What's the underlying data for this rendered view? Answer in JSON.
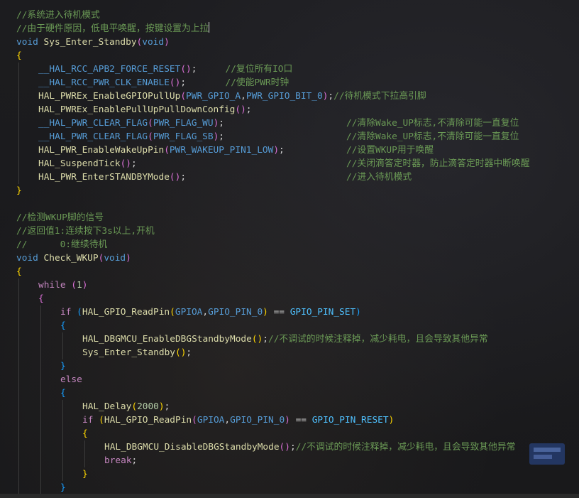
{
  "colors": {
    "comment": "#6a9955",
    "keyword": "#569cd6",
    "control": "#c586c0",
    "function": "#dcdcaa",
    "macro": "#569cd6",
    "constant": "#4fc1ff",
    "number": "#b5cea8",
    "punct": "#d4d4d4",
    "bracket1": "#ffd700",
    "bracket2": "#da70d6",
    "bracket3": "#179fff"
  },
  "editor": {
    "caret_line": 1,
    "lines": [
      {
        "indent": 0,
        "tokens": [
          {
            "t": "//系统进入待机模式",
            "c": "comment"
          }
        ]
      },
      {
        "indent": 0,
        "tokens": [
          {
            "t": "//由于硬件原因，低电平唤醒，按键设置为上拉",
            "c": "comment"
          }
        ]
      },
      {
        "indent": 0,
        "tokens": [
          {
            "t": "void",
            "c": "keyword"
          },
          {
            "t": " ",
            "c": "punct"
          },
          {
            "t": "Sys_Enter_Standby",
            "c": "function"
          },
          {
            "t": "(",
            "c": "bracket2"
          },
          {
            "t": "void",
            "c": "keyword"
          },
          {
            "t": ")",
            "c": "bracket2"
          }
        ]
      },
      {
        "indent": 0,
        "tokens": [
          {
            "t": "{",
            "c": "bracket1"
          }
        ]
      },
      {
        "indent": 1,
        "tokens": [
          {
            "t": "__HAL_RCC_APB2_FORCE_RESET",
            "c": "macro"
          },
          {
            "t": "()",
            "c": "bracket2"
          },
          {
            "t": ";",
            "c": "punct"
          }
        ],
        "comment_col": 38,
        "comment": "//复位所有IO口"
      },
      {
        "indent": 1,
        "tokens": [
          {
            "t": "__HAL_RCC_PWR_CLK_ENABLE",
            "c": "macro"
          },
          {
            "t": "()",
            "c": "bracket2"
          },
          {
            "t": ";",
            "c": "punct"
          }
        ],
        "comment_col": 38,
        "comment": "//使能PWR时钟"
      },
      {
        "indent": 1,
        "tokens": [
          {
            "t": "HAL_PWREx_EnableGPIOPullUp",
            "c": "function"
          },
          {
            "t": "(",
            "c": "bracket2"
          },
          {
            "t": "PWR_GPIO_A",
            "c": "macro"
          },
          {
            "t": ",",
            "c": "punct"
          },
          {
            "t": "PWR_GPIO_BIT_0",
            "c": "macro"
          },
          {
            "t": ")",
            "c": "bracket2"
          },
          {
            "t": ";",
            "c": "punct"
          },
          {
            "t": "//待机模式下拉高引脚",
            "c": "comment"
          }
        ]
      },
      {
        "indent": 1,
        "tokens": [
          {
            "t": "HAL_PWREx_EnablePullUpPullDownConfig",
            "c": "function"
          },
          {
            "t": "()",
            "c": "bracket2"
          },
          {
            "t": ";",
            "c": "punct"
          }
        ]
      },
      {
        "indent": 1,
        "tokens": [
          {
            "t": "__HAL_PWR_CLEAR_FLAG",
            "c": "macro"
          },
          {
            "t": "(",
            "c": "bracket2"
          },
          {
            "t": "PWR_FLAG_WU",
            "c": "macro"
          },
          {
            "t": ")",
            "c": "bracket2"
          },
          {
            "t": ";",
            "c": "punct"
          }
        ],
        "comment_col": 60,
        "comment": "//清除Wake_UP标志,不清除可能一直复位"
      },
      {
        "indent": 1,
        "tokens": [
          {
            "t": "__HAL_PWR_CLEAR_FLAG",
            "c": "macro"
          },
          {
            "t": "(",
            "c": "bracket2"
          },
          {
            "t": "PWR_FLAG_SB",
            "c": "macro"
          },
          {
            "t": ")",
            "c": "bracket2"
          },
          {
            "t": ";",
            "c": "punct"
          }
        ],
        "comment_col": 60,
        "comment": "//清除Wake_UP标志,不清除可能一直复位"
      },
      {
        "indent": 1,
        "tokens": [
          {
            "t": "HAL_PWR_EnableWakeUpPin",
            "c": "function"
          },
          {
            "t": "(",
            "c": "bracket2"
          },
          {
            "t": "PWR_WAKEUP_PIN1_LOW",
            "c": "macro"
          },
          {
            "t": ")",
            "c": "bracket2"
          },
          {
            "t": ";",
            "c": "punct"
          }
        ],
        "comment_col": 60,
        "comment": "//设置WKUP用于唤醒"
      },
      {
        "indent": 1,
        "tokens": [
          {
            "t": "HAL_SuspendTick",
            "c": "function"
          },
          {
            "t": "()",
            "c": "bracket2"
          },
          {
            "t": ";",
            "c": "punct"
          }
        ],
        "comment_col": 60,
        "comment": "//关闭滴答定时器，防止滴答定时器中断唤醒"
      },
      {
        "indent": 1,
        "tokens": [
          {
            "t": "HAL_PWR_EnterSTANDBYMode",
            "c": "function"
          },
          {
            "t": "()",
            "c": "bracket2"
          },
          {
            "t": ";",
            "c": "punct"
          }
        ],
        "comment_col": 60,
        "comment": "//进入待机模式"
      },
      {
        "indent": 0,
        "tokens": [
          {
            "t": "}",
            "c": "bracket1"
          }
        ]
      },
      {
        "indent": 0,
        "tokens": []
      },
      {
        "indent": 0,
        "tokens": [
          {
            "t": "//检测WKUP脚的信号",
            "c": "comment"
          }
        ]
      },
      {
        "indent": 0,
        "tokens": [
          {
            "t": "//返回值1:连续按下3s以上,开机",
            "c": "comment"
          }
        ]
      },
      {
        "indent": 0,
        "tokens": [
          {
            "t": "//      0:继续待机",
            "c": "comment"
          }
        ]
      },
      {
        "indent": 0,
        "tokens": [
          {
            "t": "void",
            "c": "keyword"
          },
          {
            "t": " ",
            "c": "punct"
          },
          {
            "t": "Check_WKUP",
            "c": "function"
          },
          {
            "t": "(",
            "c": "bracket2"
          },
          {
            "t": "void",
            "c": "keyword"
          },
          {
            "t": ")",
            "c": "bracket2"
          }
        ]
      },
      {
        "indent": 0,
        "tokens": [
          {
            "t": "{",
            "c": "bracket1"
          }
        ]
      },
      {
        "indent": 1,
        "tokens": [
          {
            "t": "while",
            "c": "control"
          },
          {
            "t": " ",
            "c": "punct"
          },
          {
            "t": "(",
            "c": "bracket2"
          },
          {
            "t": "1",
            "c": "number"
          },
          {
            "t": ")",
            "c": "bracket2"
          }
        ]
      },
      {
        "indent": 1,
        "tokens": [
          {
            "t": "{",
            "c": "bracket2"
          }
        ]
      },
      {
        "indent": 2,
        "tokens": [
          {
            "t": "if",
            "c": "control"
          },
          {
            "t": " ",
            "c": "punct"
          },
          {
            "t": "(",
            "c": "bracket3"
          },
          {
            "t": "HAL_GPIO_ReadPin",
            "c": "function"
          },
          {
            "t": "(",
            "c": "bracket1"
          },
          {
            "t": "GPIOA",
            "c": "macro"
          },
          {
            "t": ",",
            "c": "punct"
          },
          {
            "t": "GPIO_PIN_0",
            "c": "macro"
          },
          {
            "t": ")",
            "c": "bracket1"
          },
          {
            "t": " == ",
            "c": "punct"
          },
          {
            "t": "GPIO_PIN_SET",
            "c": "constant"
          },
          {
            "t": ")",
            "c": "bracket3"
          }
        ]
      },
      {
        "indent": 2,
        "tokens": [
          {
            "t": "{",
            "c": "bracket3"
          }
        ]
      },
      {
        "indent": 3,
        "tokens": [
          {
            "t": "HAL_DBGMCU_EnableDBGStandbyMode",
            "c": "function"
          },
          {
            "t": "()",
            "c": "bracket1"
          },
          {
            "t": ";",
            "c": "punct"
          },
          {
            "t": "//不调试的时候注释掉，减少耗电，且会导致其他异常",
            "c": "comment"
          }
        ]
      },
      {
        "indent": 3,
        "tokens": [
          {
            "t": "Sys_Enter_Standby",
            "c": "function"
          },
          {
            "t": "()",
            "c": "bracket1"
          },
          {
            "t": ";",
            "c": "punct"
          }
        ]
      },
      {
        "indent": 2,
        "tokens": [
          {
            "t": "}",
            "c": "bracket3"
          }
        ]
      },
      {
        "indent": 2,
        "tokens": [
          {
            "t": "else",
            "c": "control"
          }
        ]
      },
      {
        "indent": 2,
        "tokens": [
          {
            "t": "{",
            "c": "bracket3"
          }
        ]
      },
      {
        "indent": 3,
        "tokens": [
          {
            "t": "HAL_Delay",
            "c": "function"
          },
          {
            "t": "(",
            "c": "bracket1"
          },
          {
            "t": "2000",
            "c": "number"
          },
          {
            "t": ")",
            "c": "bracket1"
          },
          {
            "t": ";",
            "c": "punct"
          }
        ]
      },
      {
        "indent": 3,
        "tokens": [
          {
            "t": "if",
            "c": "control"
          },
          {
            "t": " ",
            "c": "punct"
          },
          {
            "t": "(",
            "c": "bracket1"
          },
          {
            "t": "HAL_GPIO_ReadPin",
            "c": "function"
          },
          {
            "t": "(",
            "c": "bracket2"
          },
          {
            "t": "GPIOA",
            "c": "macro"
          },
          {
            "t": ",",
            "c": "punct"
          },
          {
            "t": "GPIO_PIN_0",
            "c": "macro"
          },
          {
            "t": ")",
            "c": "bracket2"
          },
          {
            "t": " == ",
            "c": "punct"
          },
          {
            "t": "GPIO_PIN_RESET",
            "c": "constant"
          },
          {
            "t": ")",
            "c": "bracket1"
          }
        ]
      },
      {
        "indent": 3,
        "tokens": [
          {
            "t": "{",
            "c": "bracket1"
          }
        ]
      },
      {
        "indent": 4,
        "tokens": [
          {
            "t": "HAL_DBGMCU_DisableDBGStandbyMode",
            "c": "function"
          },
          {
            "t": "()",
            "c": "bracket2"
          },
          {
            "t": ";",
            "c": "punct"
          },
          {
            "t": "//不调试的时候注释掉，减少耗电，且会导致其他异常",
            "c": "comment"
          }
        ]
      },
      {
        "indent": 4,
        "tokens": [
          {
            "t": "break",
            "c": "control"
          },
          {
            "t": ";",
            "c": "punct"
          }
        ]
      },
      {
        "indent": 3,
        "tokens": [
          {
            "t": "}",
            "c": "bracket1"
          }
        ]
      },
      {
        "indent": 2,
        "tokens": [
          {
            "t": "}",
            "c": "bracket3"
          }
        ]
      }
    ]
  }
}
